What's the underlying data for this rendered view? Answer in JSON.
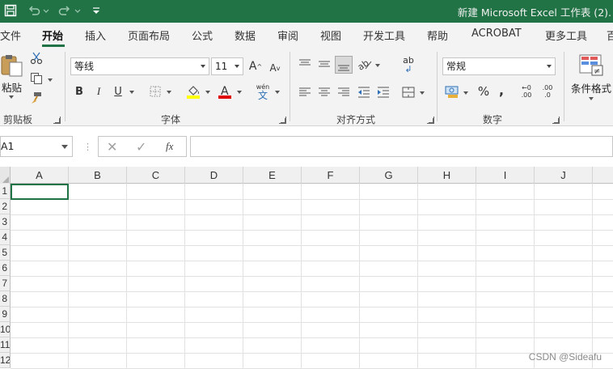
{
  "titlebar": {
    "title": "新建 Microsoft Excel 工作表 (2).",
    "background": "#217346"
  },
  "tabs": [
    "文件",
    "开始",
    "插入",
    "页面布局",
    "公式",
    "数据",
    "审阅",
    "视图",
    "开发工具",
    "帮助",
    "ACROBAT",
    "更多工具",
    "百"
  ],
  "active_tab": "开始",
  "ribbon": {
    "clipboard": {
      "paste_label": "粘贴",
      "group_label": "剪贴板"
    },
    "font": {
      "font_name": "等线",
      "font_size": "11",
      "bold": "B",
      "italic": "I",
      "underline": "U",
      "font_color_letter": "A",
      "phonetic_top": "wén",
      "phonetic_bottom": "文",
      "grow": "A",
      "shrink": "A",
      "group_label": "字体"
    },
    "alignment": {
      "group_label": "对齐方式",
      "wrap_glyph": "ab"
    },
    "number": {
      "format": "常规",
      "percent": "%",
      "comma": ",",
      "inc_decimal": ".00",
      "dec_decimal": ".0",
      "group_label": "数字"
    },
    "styles": {
      "conditional_label": "条件格式"
    }
  },
  "formula_bar": {
    "name_box": "A1",
    "fx": "fx",
    "formula": ""
  },
  "grid": {
    "columns": [
      "A",
      "B",
      "C",
      "D",
      "E",
      "F",
      "G",
      "H",
      "I",
      "J"
    ],
    "rows": [
      "1",
      "2",
      "3",
      "4",
      "5",
      "6",
      "7",
      "8",
      "9",
      "10",
      "11",
      "12"
    ],
    "selected_cell": "A1"
  },
  "watermark": "CSDN @Sideafu",
  "colors": {
    "accent": "#217346",
    "font_color_bar": "#e00000",
    "fill_color_bar": "#ffff00"
  }
}
